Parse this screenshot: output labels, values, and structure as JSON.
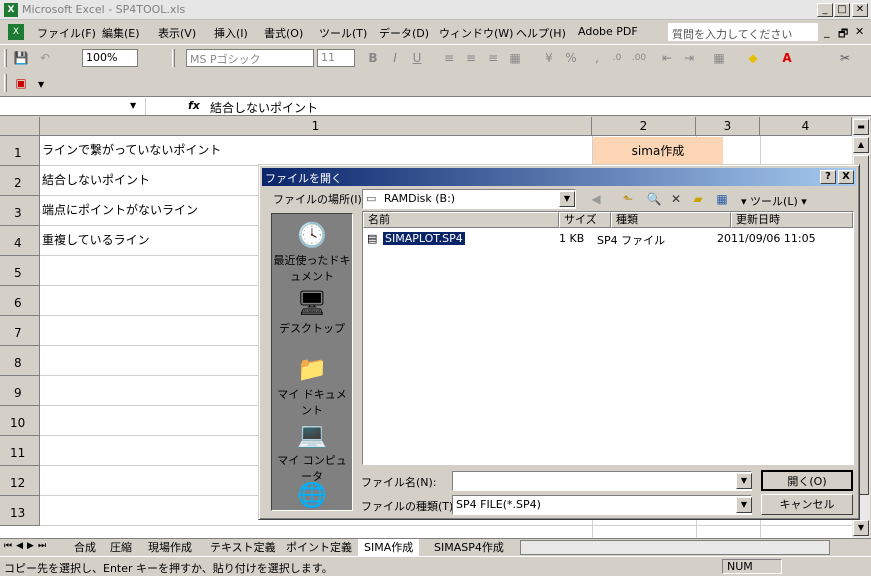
{
  "window": {
    "title": "Microsoft Excel - SP4TOOL.xls",
    "app_icon": "X"
  },
  "menu": {
    "items": [
      "ファイル(F)",
      "編集(E)",
      "表示(V)",
      "挿入(I)",
      "書式(O)",
      "ツール(T)",
      "データ(D)",
      "ウィンドウ(W)",
      "ヘルプ(H)",
      "Adobe PDF"
    ],
    "help_placeholder": "質問を入力してください"
  },
  "toolbar": {
    "zoom": "100%",
    "font_name": "MS Pゴシック",
    "font_size": "11",
    "bold": "B",
    "italic": "I",
    "underline": "U",
    "percent": "%"
  },
  "formula": {
    "name_box": "",
    "fx": "fx",
    "value": "結合しないポイント"
  },
  "grid": {
    "columns": [
      "1",
      "2",
      "3",
      "4"
    ],
    "rows": [
      "1",
      "2",
      "3",
      "4",
      "5",
      "6",
      "7",
      "8",
      "9",
      "10",
      "11",
      "12",
      "13"
    ],
    "cells": [
      {
        "row": 0,
        "text": "ラインで繋がっていないポイント"
      },
      {
        "row": 1,
        "text": "結合しないポイント"
      },
      {
        "row": 2,
        "text": "端点にポイントがないライン"
      },
      {
        "row": 3,
        "text": "重複しているライン"
      }
    ],
    "button_cell": "sima作成",
    "button_color": "#fcd5b4"
  },
  "tabs": {
    "items": [
      "合成",
      "圧縮",
      "現場作成",
      "テキスト定義",
      "ポイント定義",
      "SIMA作成",
      "SIMASP4作成"
    ],
    "active": "SIMA作成"
  },
  "status": {
    "message": "コピー先を選択し、Enter キーを押すか、貼り付けを選択します。",
    "num": "NUM"
  },
  "dialog": {
    "title": "ファイルを開く",
    "help_btn": "?",
    "close_btn": "X",
    "location_label": "ファイルの場所(I):",
    "location_value": "RAMDisk (B:)",
    "tools_label": "ツール(L)",
    "places": [
      "最近使ったドキュメント",
      "デスクトップ",
      "マイ ドキュメント",
      "マイ コンピュータ"
    ],
    "columns": [
      "名前",
      "サイズ",
      "種類",
      "更新日時"
    ],
    "files": [
      {
        "name": "SIMAPLOT.SP4",
        "size": "1 KB",
        "type": "SP4 ファイル",
        "modified": "2011/09/06 11:05"
      }
    ],
    "filename_label": "ファイル名(N):",
    "filename_value": "",
    "filetype_label": "ファイルの種類(T):",
    "filetype_value": "SP4 FILE(*.SP4)",
    "open_btn": "開く(O)",
    "cancel_btn": "キャンセル"
  }
}
